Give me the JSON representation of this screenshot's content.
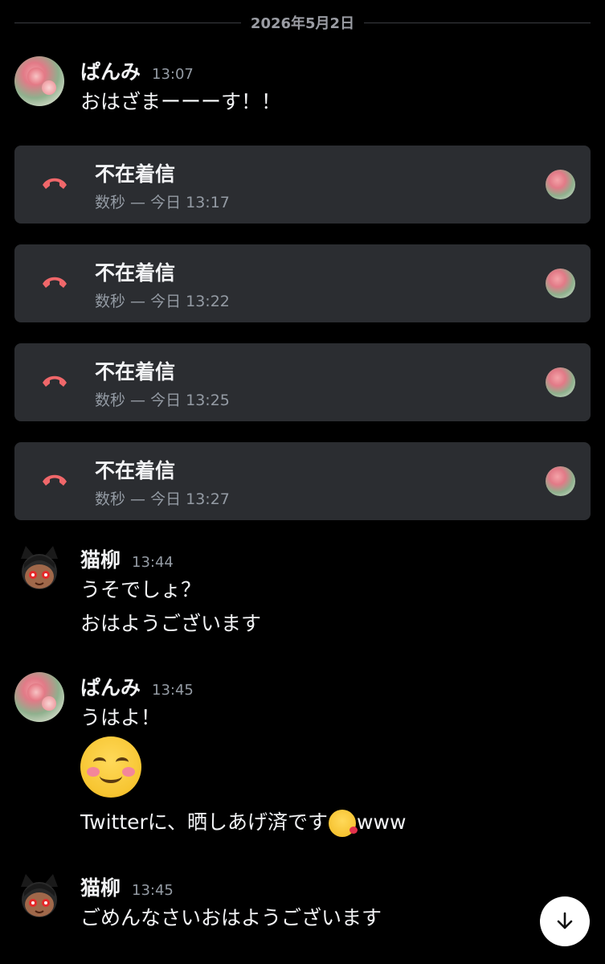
{
  "date_divider": "2026年5月2日",
  "messages": [
    {
      "user": "ぱんみ",
      "time": "13:07",
      "lines": [
        "おはざまーーーす！！"
      ]
    },
    {
      "user": "猫柳",
      "time": "13:44",
      "lines": [
        "うそでしょ？",
        "おはようございます"
      ]
    },
    {
      "user": "ぱんみ",
      "time": "13:45",
      "lines": [
        "うはよ！",
        "Twitterに、晒しあげ済です",
        "www"
      ]
    },
    {
      "user": "猫柳",
      "time": "13:45",
      "lines": [
        "ごめんなさいおはようございます"
      ]
    }
  ],
  "calls": [
    {
      "title": "不在着信",
      "sub": "数秒 — 今日 13:17"
    },
    {
      "title": "不在着信",
      "sub": "数秒 — 今日 13:22"
    },
    {
      "title": "不在着信",
      "sub": "数秒 — 今日 13:25"
    },
    {
      "title": "不在着信",
      "sub": "数秒 — 今日 13:27"
    }
  ],
  "icons": {
    "missed_call": "phone-hangup-icon",
    "scroll_down": "arrow-down-icon",
    "smile_emoji": "smiling-face-emoji",
    "kiss_emoji": "face-blowing-kiss-emoji"
  },
  "colors": {
    "background": "#000000",
    "card": "#2b2d31",
    "missed_call_red": "#f0676a",
    "muted_text": "#949ba4"
  }
}
